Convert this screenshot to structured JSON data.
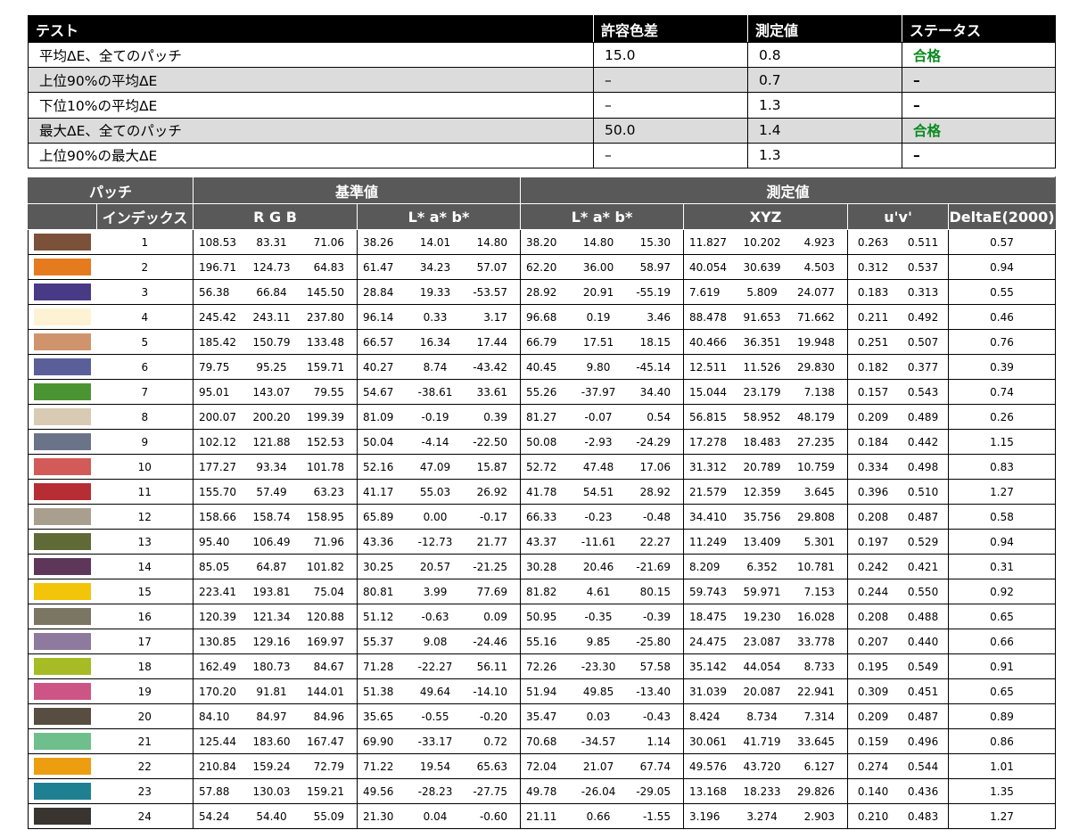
{
  "summary": {
    "headers": [
      "テスト",
      "許容色差",
      "測定値",
      "ステータス"
    ],
    "rows": [
      {
        "test": "平均ΔE、全てのパッチ",
        "tolerance": "15.0",
        "measured": "0.8",
        "status": "合格",
        "status_type": "pass"
      },
      {
        "test": "上位90%の平均ΔE",
        "tolerance": "–",
        "measured": "0.7",
        "status": "–",
        "status_type": "dash"
      },
      {
        "test": "下位10%の平均ΔE",
        "tolerance": "–",
        "measured": "1.3",
        "status": "–",
        "status_type": "dash"
      },
      {
        "test": "最大ΔE、全てのパッチ",
        "tolerance": "50.0",
        "measured": "1.4",
        "status": "合格",
        "status_type": "pass"
      },
      {
        "test": "上位90%の最大ΔE",
        "tolerance": "–",
        "measured": "1.3",
        "status": "–",
        "status_type": "dash"
      }
    ]
  },
  "patch_table": {
    "header1": {
      "patch": "パッチ",
      "reference": "基準値",
      "measured": "測定値"
    },
    "header2": {
      "index": "インデックス",
      "rgb": "R G B",
      "lab_ref": "L* a* b*",
      "lab_meas": "L* a* b*",
      "xyz": "XYZ",
      "uv": "u'v'",
      "de": "DeltaE(2000)"
    },
    "rows": [
      {
        "color": "#7b5139",
        "index": "1",
        "rgb": [
          "108.53",
          "83.31",
          "71.06"
        ],
        "lab_ref": [
          "38.26",
          "14.01",
          "14.80"
        ],
        "lab_meas": [
          "38.20",
          "14.80",
          "15.30"
        ],
        "xyz": [
          "11.827",
          "10.202",
          "4.923"
        ],
        "uv": [
          "0.263",
          "0.511"
        ],
        "de": "0.57"
      },
      {
        "color": "#e57a1e",
        "index": "2",
        "rgb": [
          "196.71",
          "124.73",
          "64.83"
        ],
        "lab_ref": [
          "61.47",
          "34.23",
          "57.07"
        ],
        "lab_meas": [
          "62.20",
          "36.00",
          "58.97"
        ],
        "xyz": [
          "40.054",
          "30.639",
          "4.503"
        ],
        "uv": [
          "0.312",
          "0.537"
        ],
        "de": "0.94"
      },
      {
        "color": "#483a86",
        "index": "3",
        "rgb": [
          "56.38",
          "66.84",
          "145.50"
        ],
        "lab_ref": [
          "28.84",
          "19.33",
          "-53.57"
        ],
        "lab_meas": [
          "28.92",
          "20.91",
          "-55.19"
        ],
        "xyz": [
          "7.619",
          "5.809",
          "24.077"
        ],
        "uv": [
          "0.183",
          "0.313"
        ],
        "de": "0.55"
      },
      {
        "color": "#fdf2d4",
        "index": "4",
        "rgb": [
          "245.42",
          "243.11",
          "237.80"
        ],
        "lab_ref": [
          "96.14",
          "0.33",
          "3.17"
        ],
        "lab_meas": [
          "96.68",
          "0.19",
          "3.46"
        ],
        "xyz": [
          "88.478",
          "91.653",
          "71.662"
        ],
        "uv": [
          "0.211",
          "0.492"
        ],
        "de": "0.46"
      },
      {
        "color": "#d0946d",
        "index": "5",
        "rgb": [
          "185.42",
          "150.79",
          "133.48"
        ],
        "lab_ref": [
          "66.57",
          "16.34",
          "17.44"
        ],
        "lab_meas": [
          "66.79",
          "17.51",
          "18.15"
        ],
        "xyz": [
          "40.466",
          "36.351",
          "19.948"
        ],
        "uv": [
          "0.251",
          "0.507"
        ],
        "de": "0.76"
      },
      {
        "color": "#5a5f9a",
        "index": "6",
        "rgb": [
          "79.75",
          "95.25",
          "159.71"
        ],
        "lab_ref": [
          "40.27",
          "8.74",
          "-43.42"
        ],
        "lab_meas": [
          "40.45",
          "9.80",
          "-45.14"
        ],
        "xyz": [
          "12.511",
          "11.526",
          "29.830"
        ],
        "uv": [
          "0.182",
          "0.377"
        ],
        "de": "0.39"
      },
      {
        "color": "#4a9433",
        "index": "7",
        "rgb": [
          "95.01",
          "143.07",
          "79.55"
        ],
        "lab_ref": [
          "54.67",
          "-38.61",
          "33.61"
        ],
        "lab_meas": [
          "55.26",
          "-37.97",
          "34.40"
        ],
        "xyz": [
          "15.044",
          "23.179",
          "7.138"
        ],
        "uv": [
          "0.157",
          "0.543"
        ],
        "de": "0.74"
      },
      {
        "color": "#d9cab4",
        "index": "8",
        "rgb": [
          "200.07",
          "200.20",
          "199.39"
        ],
        "lab_ref": [
          "81.09",
          "-0.19",
          "0.39"
        ],
        "lab_meas": [
          "81.27",
          "-0.07",
          "0.54"
        ],
        "xyz": [
          "56.815",
          "58.952",
          "48.179"
        ],
        "uv": [
          "0.209",
          "0.489"
        ],
        "de": "0.26"
      },
      {
        "color": "#6a7388",
        "index": "9",
        "rgb": [
          "102.12",
          "121.88",
          "152.53"
        ],
        "lab_ref": [
          "50.04",
          "-4.14",
          "-22.50"
        ],
        "lab_meas": [
          "50.08",
          "-2.93",
          "-24.29"
        ],
        "xyz": [
          "17.278",
          "18.483",
          "27.235"
        ],
        "uv": [
          "0.184",
          "0.442"
        ],
        "de": "1.15"
      },
      {
        "color": "#d25a58",
        "index": "10",
        "rgb": [
          "177.27",
          "93.34",
          "101.78"
        ],
        "lab_ref": [
          "52.16",
          "47.09",
          "15.87"
        ],
        "lab_meas": [
          "52.72",
          "47.48",
          "17.06"
        ],
        "xyz": [
          "31.312",
          "20.789",
          "10.759"
        ],
        "uv": [
          "0.334",
          "0.498"
        ],
        "de": "0.83"
      },
      {
        "color": "#b62d33",
        "index": "11",
        "rgb": [
          "155.70",
          "57.49",
          "63.23"
        ],
        "lab_ref": [
          "41.17",
          "55.03",
          "26.92"
        ],
        "lab_meas": [
          "41.78",
          "54.51",
          "28.92"
        ],
        "xyz": [
          "21.579",
          "12.359",
          "3.645"
        ],
        "uv": [
          "0.396",
          "0.510"
        ],
        "de": "1.27"
      },
      {
        "color": "#a99f8e",
        "index": "12",
        "rgb": [
          "158.66",
          "158.74",
          "158.95"
        ],
        "lab_ref": [
          "65.89",
          "0.00",
          "-0.17"
        ],
        "lab_meas": [
          "66.33",
          "-0.23",
          "-0.48"
        ],
        "xyz": [
          "34.410",
          "35.756",
          "29.808"
        ],
        "uv": [
          "0.208",
          "0.487"
        ],
        "de": "0.58"
      },
      {
        "color": "#5f6a36",
        "index": "13",
        "rgb": [
          "95.40",
          "106.49",
          "71.96"
        ],
        "lab_ref": [
          "43.36",
          "-12.73",
          "21.77"
        ],
        "lab_meas": [
          "43.37",
          "-11.61",
          "22.27"
        ],
        "xyz": [
          "11.249",
          "13.409",
          "5.301"
        ],
        "uv": [
          "0.197",
          "0.529"
        ],
        "de": "0.94"
      },
      {
        "color": "#5d3659",
        "index": "14",
        "rgb": [
          "85.05",
          "64.87",
          "101.82"
        ],
        "lab_ref": [
          "30.25",
          "20.57",
          "-21.25"
        ],
        "lab_meas": [
          "30.28",
          "20.46",
          "-21.69"
        ],
        "xyz": [
          "8.209",
          "6.352",
          "10.781"
        ],
        "uv": [
          "0.242",
          "0.421"
        ],
        "de": "0.31"
      },
      {
        "color": "#f2c40a",
        "index": "15",
        "rgb": [
          "223.41",
          "193.81",
          "75.04"
        ],
        "lab_ref": [
          "80.81",
          "3.99",
          "77.69"
        ],
        "lab_meas": [
          "81.82",
          "4.61",
          "80.15"
        ],
        "xyz": [
          "59.743",
          "59.971",
          "7.153"
        ],
        "uv": [
          "0.244",
          "0.550"
        ],
        "de": "0.92"
      },
      {
        "color": "#7b7563",
        "index": "16",
        "rgb": [
          "120.39",
          "121.34",
          "120.88"
        ],
        "lab_ref": [
          "51.12",
          "-0.63",
          "0.09"
        ],
        "lab_meas": [
          "50.95",
          "-0.35",
          "-0.39"
        ],
        "xyz": [
          "18.475",
          "19.230",
          "16.028"
        ],
        "uv": [
          "0.208",
          "0.488"
        ],
        "de": "0.65"
      },
      {
        "color": "#8d7a9e",
        "index": "17",
        "rgb": [
          "130.85",
          "129.16",
          "169.97"
        ],
        "lab_ref": [
          "55.37",
          "9.08",
          "-24.46"
        ],
        "lab_meas": [
          "55.16",
          "9.85",
          "-25.80"
        ],
        "xyz": [
          "24.475",
          "23.087",
          "33.778"
        ],
        "uv": [
          "0.207",
          "0.440"
        ],
        "de": "0.66"
      },
      {
        "color": "#a6bb24",
        "index": "18",
        "rgb": [
          "162.49",
          "180.73",
          "84.67"
        ],
        "lab_ref": [
          "71.28",
          "-22.27",
          "56.11"
        ],
        "lab_meas": [
          "72.26",
          "-23.30",
          "57.58"
        ],
        "xyz": [
          "35.142",
          "44.054",
          "8.733"
        ],
        "uv": [
          "0.195",
          "0.549"
        ],
        "de": "0.91"
      },
      {
        "color": "#cd5585",
        "index": "19",
        "rgb": [
          "170.20",
          "91.81",
          "144.01"
        ],
        "lab_ref": [
          "51.38",
          "49.64",
          "-14.10"
        ],
        "lab_meas": [
          "51.94",
          "49.85",
          "-13.40"
        ],
        "xyz": [
          "31.039",
          "20.087",
          "22.941"
        ],
        "uv": [
          "0.309",
          "0.451"
        ],
        "de": "0.65"
      },
      {
        "color": "#574d40",
        "index": "20",
        "rgb": [
          "84.10",
          "84.97",
          "84.96"
        ],
        "lab_ref": [
          "35.65",
          "-0.55",
          "-0.20"
        ],
        "lab_meas": [
          "35.47",
          "0.03",
          "-0.43"
        ],
        "xyz": [
          "8.424",
          "8.734",
          "7.314"
        ],
        "uv": [
          "0.209",
          "0.487"
        ],
        "de": "0.89"
      },
      {
        "color": "#6ebf8b",
        "index": "21",
        "rgb": [
          "125.44",
          "183.60",
          "167.47"
        ],
        "lab_ref": [
          "69.90",
          "-33.17",
          "0.72"
        ],
        "lab_meas": [
          "70.68",
          "-34.57",
          "1.14"
        ],
        "xyz": [
          "30.061",
          "41.719",
          "33.645"
        ],
        "uv": [
          "0.159",
          "0.496"
        ],
        "de": "0.86"
      },
      {
        "color": "#ec9d10",
        "index": "22",
        "rgb": [
          "210.84",
          "159.24",
          "72.79"
        ],
        "lab_ref": [
          "71.22",
          "19.54",
          "65.63"
        ],
        "lab_meas": [
          "72.04",
          "21.07",
          "67.74"
        ],
        "xyz": [
          "49.576",
          "43.720",
          "6.127"
        ],
        "uv": [
          "0.274",
          "0.544"
        ],
        "de": "1.01"
      },
      {
        "color": "#1f8092",
        "index": "23",
        "rgb": [
          "57.88",
          "130.03",
          "159.21"
        ],
        "lab_ref": [
          "49.56",
          "-28.23",
          "-27.75"
        ],
        "lab_meas": [
          "49.78",
          "-26.04",
          "-29.05"
        ],
        "xyz": [
          "13.168",
          "18.233",
          "29.826"
        ],
        "uv": [
          "0.140",
          "0.436"
        ],
        "de": "1.35"
      },
      {
        "color": "#3a3430",
        "index": "24",
        "rgb": [
          "54.24",
          "54.40",
          "55.09"
        ],
        "lab_ref": [
          "21.30",
          "0.04",
          "-0.60"
        ],
        "lab_meas": [
          "21.11",
          "0.66",
          "-1.55"
        ],
        "xyz": [
          "3.196",
          "3.274",
          "2.903"
        ],
        "uv": [
          "0.210",
          "0.483"
        ],
        "de": "1.27"
      }
    ]
  }
}
